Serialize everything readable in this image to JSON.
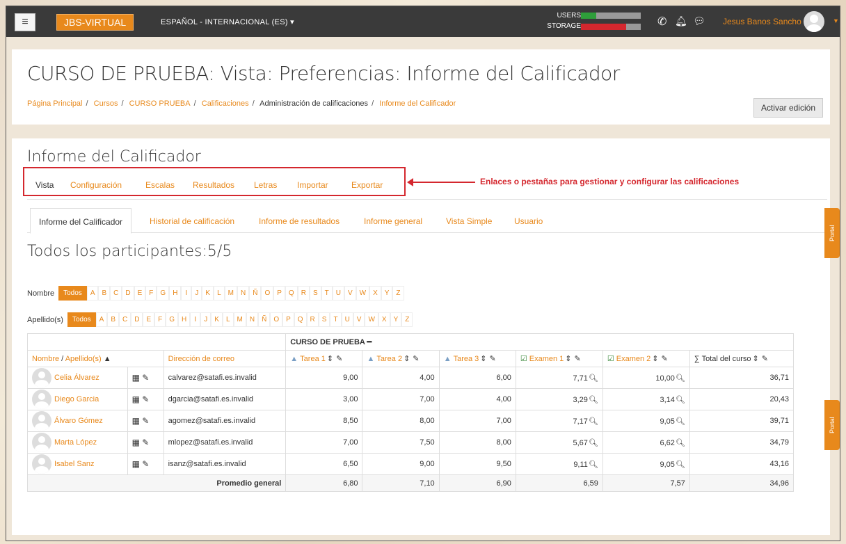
{
  "nav": {
    "menu_icon": "hamburger-icon",
    "brand": "JBS-VIRTUAL",
    "language": "ESPAÑOL - INTERNACIONAL (ES)",
    "usage_users_label": "USERS",
    "usage_storage_label": "STORAGE",
    "users_fraction": 0.25,
    "storage_fraction": 0.75,
    "colors": {
      "users": "#2e9e3a",
      "storage": "#d4272e"
    },
    "user_name": "Jesus Banos Sancho"
  },
  "header": {
    "title": "CURSO DE PRUEBA: Vista: Preferencias: Informe del Calificador",
    "breadcrumb": [
      "Página Principal",
      "Cursos",
      "CURSO PRUEBA",
      "Calificaciones",
      "Administración de calificaciones",
      "Informe del Calificador"
    ],
    "edit_button": "Activar edición"
  },
  "main": {
    "section_title": "Informe del Calificador",
    "tabs": [
      "Vista",
      "Configuración",
      "Escalas",
      "Resultados",
      "Letras",
      "Importar",
      "Exportar"
    ],
    "annotation": "Enlaces o pestañas para gestionar y configurar las calificaciones",
    "subtabs": [
      "Informe del Calificador",
      "Historial de calificación",
      "Informe de resultados",
      "Informe general",
      "Vista Simple",
      "Usuario"
    ],
    "participants": "Todos los participantes:5/5",
    "first_name_label": "Nombre",
    "last_name_label": "Apellido(s)",
    "all_label": "Todos",
    "letters": [
      "A",
      "B",
      "C",
      "D",
      "E",
      "F",
      "G",
      "H",
      "I",
      "J",
      "K",
      "L",
      "M",
      "N",
      "Ñ",
      "O",
      "P",
      "Q",
      "R",
      "S",
      "T",
      "U",
      "V",
      "W",
      "X",
      "Y",
      "Z"
    ]
  },
  "table": {
    "course_header": "CURSO DE PRUEBA",
    "col_name_a": "Nombre",
    "col_name_sep": " / ",
    "col_name_b": "Apellido(s)",
    "col_email": "Dirección de correo",
    "items": [
      "Tarea 1",
      "Tarea 2",
      "Tarea 3",
      "Examen 1",
      "Examen 2"
    ],
    "col_total": "Total del curso",
    "rows": [
      {
        "name": "Celia Álvarez",
        "email": "calvarez@satafi.es.invalid",
        "t1": "9,00",
        "t2": "4,00",
        "t3": "6,00",
        "e1": "7,71",
        "e2": "10,00",
        "total": "36,71"
      },
      {
        "name": "Diego Garcia",
        "email": "dgarcia@satafi.es.invalid",
        "t1": "3,00",
        "t2": "7,00",
        "t3": "4,00",
        "e1": "3,29",
        "e2": "3,14",
        "total": "20,43"
      },
      {
        "name": "Álvaro Gómez",
        "email": "agomez@satafi.es.invalid",
        "t1": "8,50",
        "t2": "8,00",
        "t3": "7,00",
        "e1": "7,17",
        "e2": "9,05",
        "total": "39,71"
      },
      {
        "name": "Marta López",
        "email": "mlopez@satafi.es.invalid",
        "t1": "7,00",
        "t2": "7,50",
        "t3": "8,00",
        "e1": "5,67",
        "e2": "6,62",
        "total": "34,79"
      },
      {
        "name": "Isabel Sanz",
        "email": "isanz@satafi.es.invalid",
        "t1": "6,50",
        "t2": "9,00",
        "t3": "9,50",
        "e1": "9,11",
        "e2": "9,05",
        "total": "43,16"
      }
    ],
    "avg_label": "Promedio general",
    "avg": {
      "t1": "6,80",
      "t2": "7,10",
      "t3": "6,90",
      "e1": "6,59",
      "e2": "7,57",
      "total": "34,96"
    }
  },
  "side": {
    "portal_label": "Portal"
  }
}
